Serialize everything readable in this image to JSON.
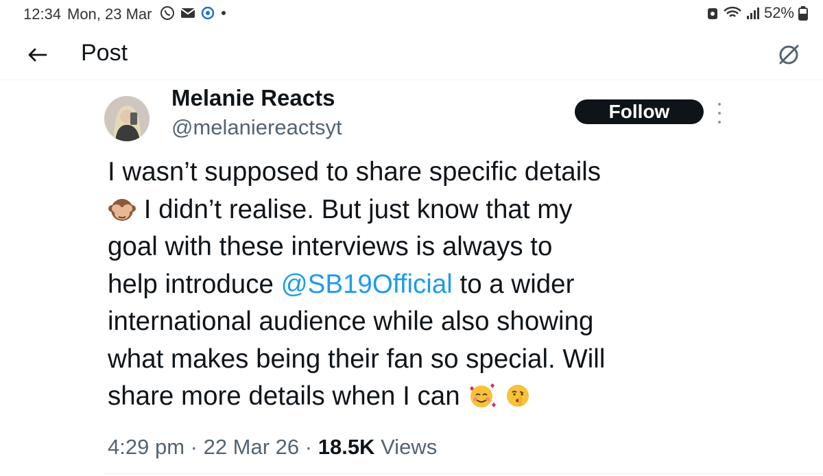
{
  "status_bar": {
    "time": "12:34",
    "date": "Mon, 23 Mar",
    "battery": "52%",
    "icons": [
      "viber-icon",
      "mail-icon",
      "target-icon",
      "dot-icon",
      "recycle-icon",
      "wifi-icon",
      "signal-icon",
      "battery-icon"
    ]
  },
  "header": {
    "title": "Post",
    "back_icon": "arrow-left-icon",
    "grok_icon": "grok-icon"
  },
  "post": {
    "author_name": "Melanie Reacts",
    "author_handle": "@melaniereactsyt",
    "follow_label": "Follow",
    "text_lines": [
      {
        "before": "I wasn’t supposed to share specific details"
      },
      {
        "emoji": "see-no-evil-monkey-emoji",
        "after": " I didn’t realise. But just know that my"
      },
      {
        "before": "goal with these interviews is always to"
      },
      {
        "before": "help introduce ",
        "mention": "@SB19Official",
        "after": " to a wider"
      },
      {
        "before": "international audience while also showing"
      },
      {
        "before": "what makes being their fan so special. Will"
      },
      {
        "before": "share more details when I can ",
        "emoji2": "smiling-face-with-hearts-emoji",
        "emoji3": "shushing-face-emoji"
      }
    ],
    "time": "4:29 pm",
    "separator": " · ",
    "date": "22 Mar 26",
    "views_count": "18.5K",
    "views_label": " Views"
  },
  "colors": {
    "text": "#0f1419",
    "secondary": "#536471",
    "link": "#1d9bf0",
    "follow_bg": "#0f1419"
  }
}
